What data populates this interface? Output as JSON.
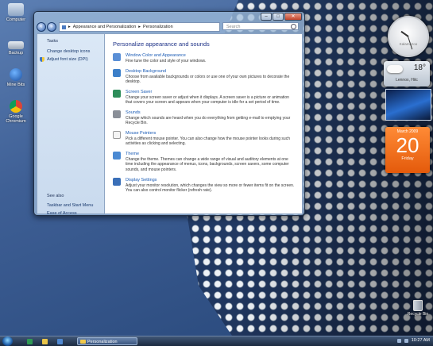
{
  "desktop": {
    "icons": [
      {
        "label": "Computer"
      },
      {
        "label": "Backup"
      },
      {
        "label": "Mine Bits"
      },
      {
        "label": "Google Chromium"
      }
    ],
    "recycle_label": "Recycle Bin"
  },
  "window": {
    "title_buttons": {
      "minimize": "–",
      "maximize": "□",
      "close": "✕"
    },
    "breadcrumb": [
      "Appearance and Personalization",
      "Personalization"
    ],
    "search_placeholder": "Search"
  },
  "leftpane": {
    "tasks_title": "Tasks",
    "tasks": [
      "Change desktop icons",
      "Adjust font size (DPI)"
    ],
    "see_also_title": "See also",
    "see_also": [
      "Taskbar and Start Menu",
      "Ease of Access"
    ]
  },
  "main": {
    "title": "Personalize appearance and sounds",
    "items": [
      {
        "title": "Window Color and Appearance",
        "desc": "Fine tune the color and style of your windows.",
        "icon_color": "#5a8fd6"
      },
      {
        "title": "Desktop Background",
        "desc": "Choose from available backgrounds or colors or use one of your own pictures to decorate the desktop.",
        "icon_color": "#3c7fc9"
      },
      {
        "title": "Screen Saver",
        "desc": "Change your screen saver or adjust when it displays. A screen saver is a picture or animation that covers your screen and appears when your computer is idle for a set period of time.",
        "icon_color": "#2d8d5a"
      },
      {
        "title": "Sounds",
        "desc": "Change which sounds are heard when you do everything from getting e-mail to emptying your Recycle Bin.",
        "icon_color": "#8a8f98"
      },
      {
        "title": "Mouse Pointers",
        "desc": "Pick a different mouse pointer. You can also change how the mouse pointer looks during such activities as clicking and selecting.",
        "icon_color": "#f4f4f4"
      },
      {
        "title": "Theme",
        "desc": "Change the theme. Themes can change a wide range of visual and auditory elements at one time including the appearance of menus, icons, backgrounds, screen savers, some computer sounds, and mouse pointers.",
        "icon_color": "#4b8ad3"
      },
      {
        "title": "Display Settings",
        "desc": "Adjust your monitor resolution, which changes the view so more or fewer items fit on the screen. You can also control monitor flicker (refresh rate).",
        "icon_color": "#3a6fb8"
      }
    ]
  },
  "gadgets": {
    "clock_label": "Kalamazoo",
    "weather_temp": "18°",
    "weather_city": "Lennox, Hitc",
    "calendar_month": "March 2009",
    "calendar_day": "20",
    "calendar_weekday": "Friday"
  },
  "taskbar": {
    "task_label": "Personalization",
    "time": "10:27 AM"
  }
}
